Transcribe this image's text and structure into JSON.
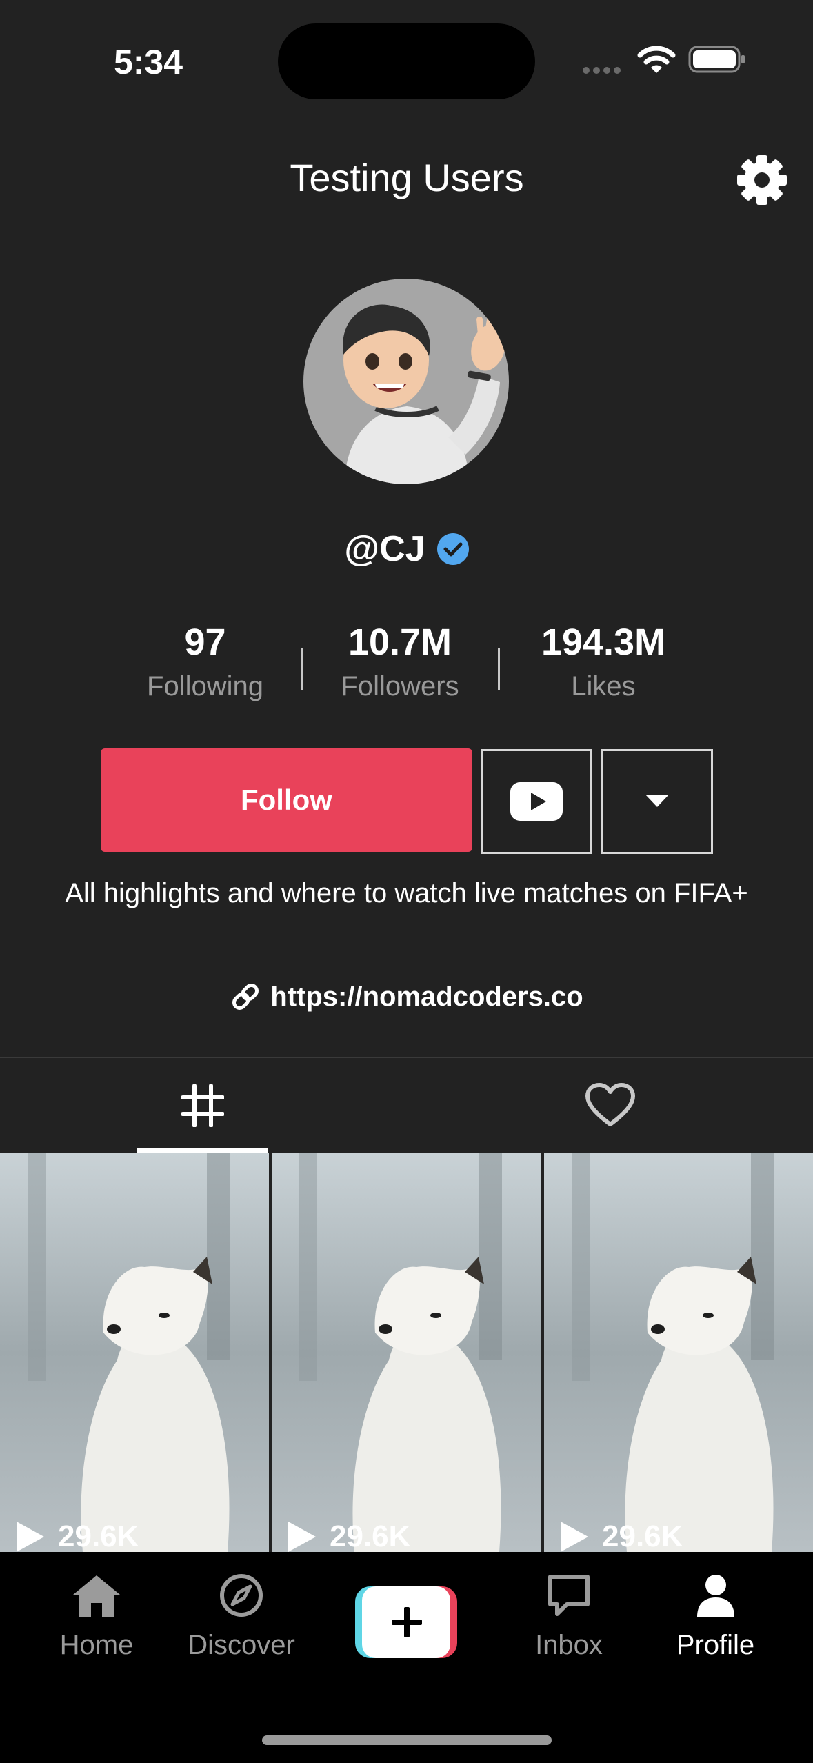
{
  "status_bar": {
    "time": "5:34"
  },
  "header": {
    "title": "Testing Users"
  },
  "profile": {
    "username": "@CJ",
    "stats": [
      {
        "value": "97",
        "label": "Following"
      },
      {
        "value": "10.7M",
        "label": "Followers"
      },
      {
        "value": "194.3M",
        "label": "Likes"
      }
    ],
    "follow_label": "Follow",
    "bio": "All highlights and where to watch live matches on FIFA+",
    "link": "https://nomadcoders.co"
  },
  "videos": [
    {
      "views": "29.6K"
    },
    {
      "views": "29.6K"
    },
    {
      "views": "29.6K"
    }
  ],
  "bottom_nav": {
    "items": [
      {
        "label": "Home"
      },
      {
        "label": "Discover"
      },
      {
        "label": "Inbox"
      },
      {
        "label": "Profile"
      }
    ]
  },
  "colors": {
    "background": "#222222",
    "accent": "#e9425a",
    "verified": "#52a7ef",
    "nav_bg": "#000000"
  },
  "icons": [
    "wifi-icon",
    "battery-icon",
    "gear-icon",
    "verified-icon",
    "youtube-icon",
    "caret-down-icon",
    "link-icon",
    "grid-icon",
    "heart-icon",
    "play-icon",
    "home-icon",
    "compass-icon",
    "plus-icon",
    "inbox-icon",
    "profile-icon"
  ]
}
